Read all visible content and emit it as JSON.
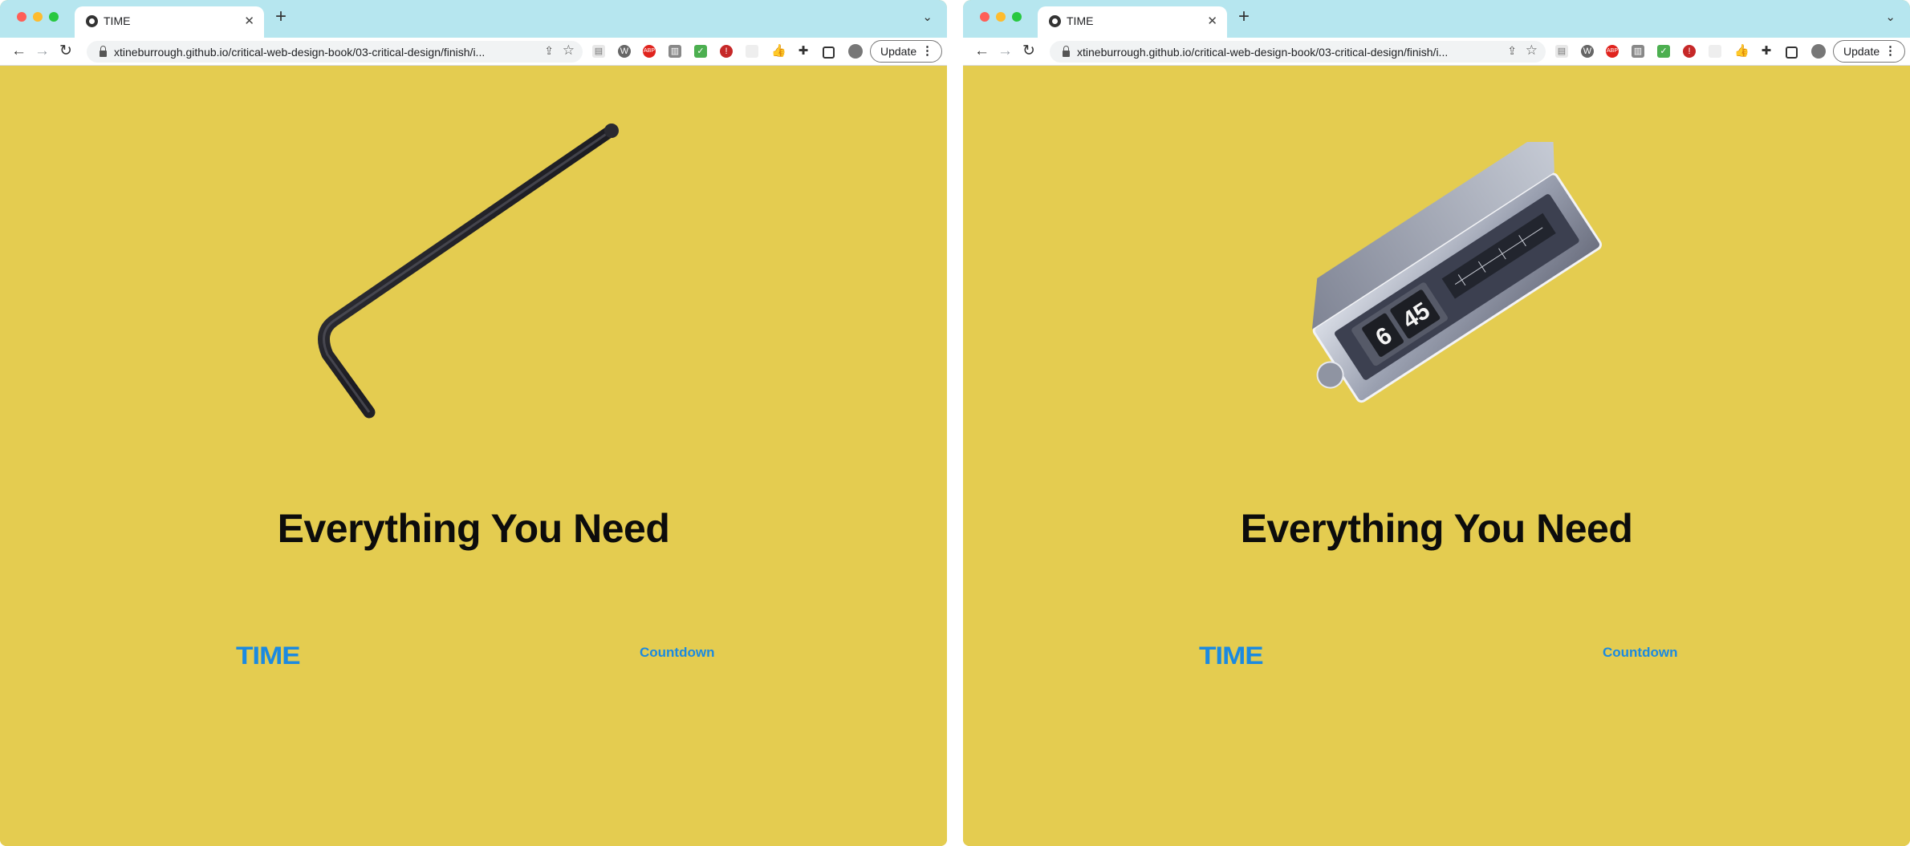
{
  "windows": [
    {
      "tab": {
        "title": "TIME"
      },
      "address_bar": {
        "url": "xtineburrough.github.io/critical-web-design-book/03-critical-design/finish/i..."
      },
      "toolbar": {
        "update_label": "Update"
      },
      "page": {
        "hero_image": "hex-key-wrench",
        "headline": "Everything You Need",
        "nav": {
          "brand": "TIME",
          "link": "Countdown"
        }
      }
    },
    {
      "tab": {
        "title": "TIME"
      },
      "address_bar": {
        "url": "xtineburrough.github.io/critical-web-design-book/03-critical-design/finish/i..."
      },
      "toolbar": {
        "update_label": "Update"
      },
      "page": {
        "hero_image": "flip-clock-radio",
        "clock_digits": {
          "hour": "6",
          "minutes": "45"
        },
        "headline": "Everything You Need",
        "nav": {
          "brand": "TIME",
          "link": "Countdown"
        }
      }
    }
  ],
  "extensions": [
    "doc-icon",
    "wp-icon",
    "abp-icon",
    "trash-icon",
    "check-icon",
    "shield-icon",
    "blank-icon",
    "thumbs-up-icon",
    "puzzle-icon",
    "sidebar-icon",
    "profile-avatar"
  ],
  "colors": {
    "page_bg": "#e4cc50",
    "link": "#1b8ae0",
    "tabbar": "#b6e6ef"
  }
}
